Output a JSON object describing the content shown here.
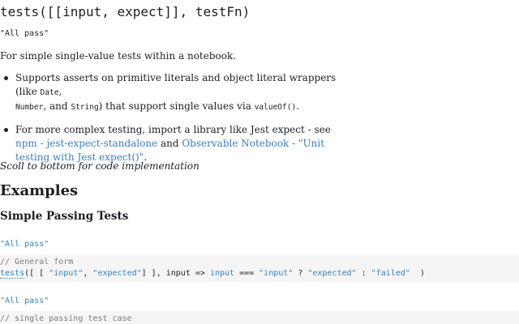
{
  "title_cell": {
    "signature": "tests([[input, expect]], testFn)",
    "output": "\"All pass\""
  },
  "intro": {
    "text": "For simple single-value tests within a notebook."
  },
  "bullets": [
    {
      "prefix": "Supports asserts on primitive literals and object literal wrappers (like ",
      "code1": "Date",
      "sep1": ",",
      "code2": "Number",
      "sep2": ", and ",
      "code3": "String",
      "middle": ") that support single values via ",
      "code4": "valueOf()",
      "suffix": "."
    },
    {
      "prefix": "For more complex testing, import a library like Jest expect - see ",
      "link1": "npm - jest-expect-standalone",
      "and": " and ",
      "link2": "Observable Notebook - \"Unit testing with Jest expect()\"",
      "suffix": "."
    }
  ],
  "scroll_note": "Scoll to bottom for code implementation",
  "examples_heading": "Examples",
  "simple_heading": "Simple Passing Tests",
  "example1": {
    "output": "\"All pass\"",
    "comment": "// General form",
    "fn": "tests",
    "p1": "([ [ ",
    "s1": "\"input\"",
    "c1": ", ",
    "s2": "\"expected\"",
    "p2": "] ], input => ",
    "v1": "input",
    "p3": " === ",
    "s3": "\"input\"",
    "p4": " ? ",
    "s4": "\"expected\"",
    "p5": " : ",
    "s5": "\"failed\"",
    "p6": "  )"
  },
  "example2": {
    "output": "\"All pass\"",
    "comment": "// single passing test case"
  },
  "colors": {
    "link": "#3b7cc4",
    "string": "#3182bd",
    "code_background": "#f5f5f5"
  }
}
